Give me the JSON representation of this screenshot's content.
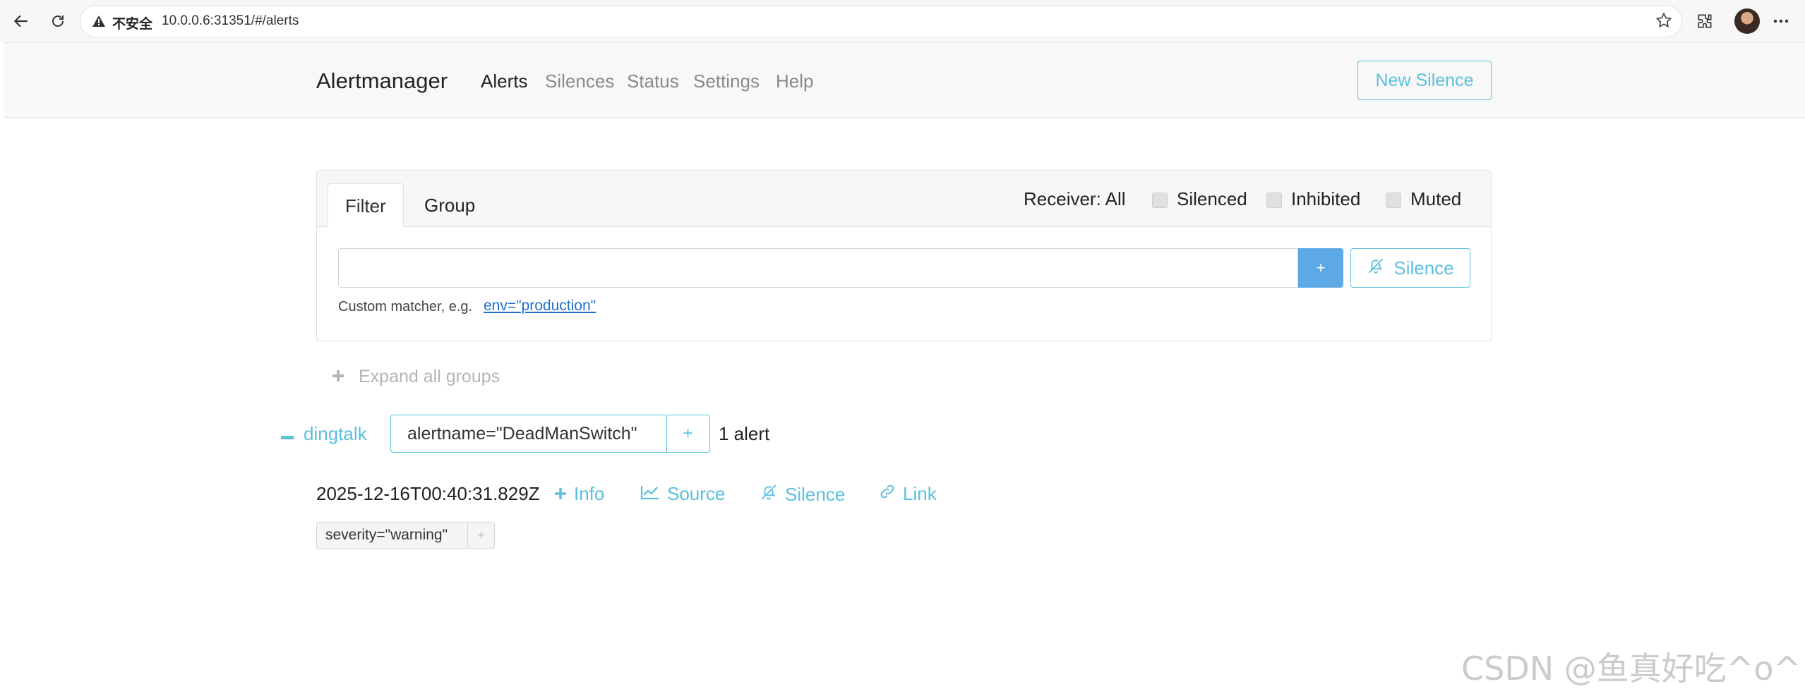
{
  "browser": {
    "security_label": "不安全",
    "url": "10.0.0.6:31351/#/alerts"
  },
  "nav": {
    "brand": "Alertmanager",
    "items": [
      "Alerts",
      "Silences",
      "Status",
      "Settings",
      "Help"
    ],
    "active": "Alerts",
    "new_silence": "New Silence"
  },
  "filter": {
    "tabs": [
      "Filter",
      "Group"
    ],
    "receiver": "Receiver: All",
    "checkboxes": [
      {
        "label": "Silenced",
        "checked": false
      },
      {
        "label": "Inhibited",
        "checked": false
      },
      {
        "label": "Muted",
        "checked": false
      }
    ],
    "input_value": "",
    "add_label": "+",
    "silence_label": "Silence",
    "hint": "Custom matcher, e.g.",
    "hint_example": "env=\"production\""
  },
  "groups": {
    "expand_all": "Expand all groups",
    "group": {
      "receiver": "dingtalk",
      "matcher": "alertname=\"DeadManSwitch\"",
      "matcher_plus": "+",
      "count": "1 alert"
    },
    "alert": {
      "time": "2025-12-16T00:40:31.829Z",
      "actions": [
        "Info",
        "Source",
        "Silence",
        "Link"
      ],
      "label": "severity=\"warning\"",
      "label_plus": "+"
    }
  },
  "watermark": "CSDN @鱼真好吃^o^",
  "colors": {
    "accent": "#5bc0de",
    "primary_button": "#5da9e6",
    "link": "#1f6fd1"
  }
}
